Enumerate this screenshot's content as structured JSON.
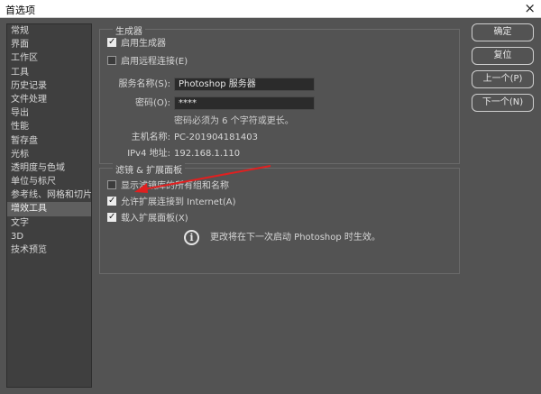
{
  "window": {
    "title": "首选项",
    "close_glyph": "×"
  },
  "sidebar": {
    "items": [
      {
        "label": "常规"
      },
      {
        "label": "界面"
      },
      {
        "label": "工作区"
      },
      {
        "label": "工具"
      },
      {
        "label": "历史记录"
      },
      {
        "label": "文件处理"
      },
      {
        "label": "导出"
      },
      {
        "label": "性能"
      },
      {
        "label": "暂存盘"
      },
      {
        "label": "光标"
      },
      {
        "label": "透明度与色域"
      },
      {
        "label": "单位与标尺"
      },
      {
        "label": "参考线、网格和切片"
      },
      {
        "label": "增效工具",
        "active": true
      },
      {
        "label": "文字"
      },
      {
        "label": "3D"
      },
      {
        "label": "技术预览"
      }
    ]
  },
  "generator": {
    "group_title": "生成器",
    "enable_generator": {
      "label": "启用生成器",
      "checked": true
    },
    "enable_remote": {
      "label": "启用远程连接(E)",
      "checked": false
    },
    "service_name": {
      "label": "服务名称(S):",
      "value": "Photoshop 服务器"
    },
    "password": {
      "label": "密码(O):",
      "value": "****"
    },
    "password_hint": "密码必须为 6 个字符或更长。",
    "host_name": {
      "label": "主机名称:",
      "value": "PC-201904181403"
    },
    "ipv4": {
      "label": "IPv4 地址:",
      "value": "192.168.1.110"
    }
  },
  "filters": {
    "group_title": "滤镜 & 扩展面板",
    "show_all_filters": {
      "label": "显示滤镜库的所有组和名称",
      "checked": false
    },
    "allow_internet": {
      "label": "允许扩展连接到 Internet(A)",
      "checked": true
    },
    "load_panels": {
      "label": "载入扩展面板(X)",
      "checked": true
    },
    "info_text": "更改将在下一次启动 Photoshop 时生效。",
    "info_glyph": "i"
  },
  "buttons": {
    "ok": "确定",
    "reset": "复位",
    "prev": "上一个(P)",
    "next": "下一个(N)"
  },
  "colors": {
    "background": "#535353",
    "sidebar": "#3f3f3f",
    "annotation_arrow": "#e02020"
  }
}
